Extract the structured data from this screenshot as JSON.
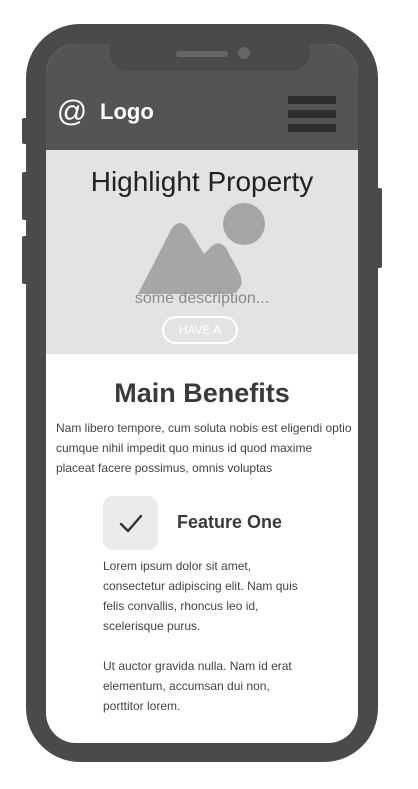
{
  "header": {
    "logo_symbol": "@",
    "logo_text": "Logo",
    "menu_icon": "hamburger-menu-icon"
  },
  "hero": {
    "title": "Highlight Property",
    "image_icon": "image-placeholder-icon",
    "description": "some description...",
    "button_label": "HAVE A"
  },
  "benefits": {
    "title": "Main Benefits",
    "text": "Nam libero tempore, cum soluta nobis est eligendi optio cumque nihil impedit quo minus id quod maxime placeat facere possimus, omnis voluptas"
  },
  "feature": {
    "icon": "checkmark-icon",
    "title": "Feature One",
    "paragraph_1": "Lorem ipsum dolor sit amet, consectetur adipiscing elit. Nam quis felis convallis, rhoncus leo id, scelerisque purus.",
    "paragraph_2": "Ut auctor gravida nulla. Nam id erat elementum, accumsan dui non, porttitor lorem."
  },
  "colors": {
    "phone_frame": "#4a4a4a",
    "header_bg": "#545454",
    "hero_bg": "#e3e3e3",
    "placeholder_shape": "#a6a6a6"
  }
}
